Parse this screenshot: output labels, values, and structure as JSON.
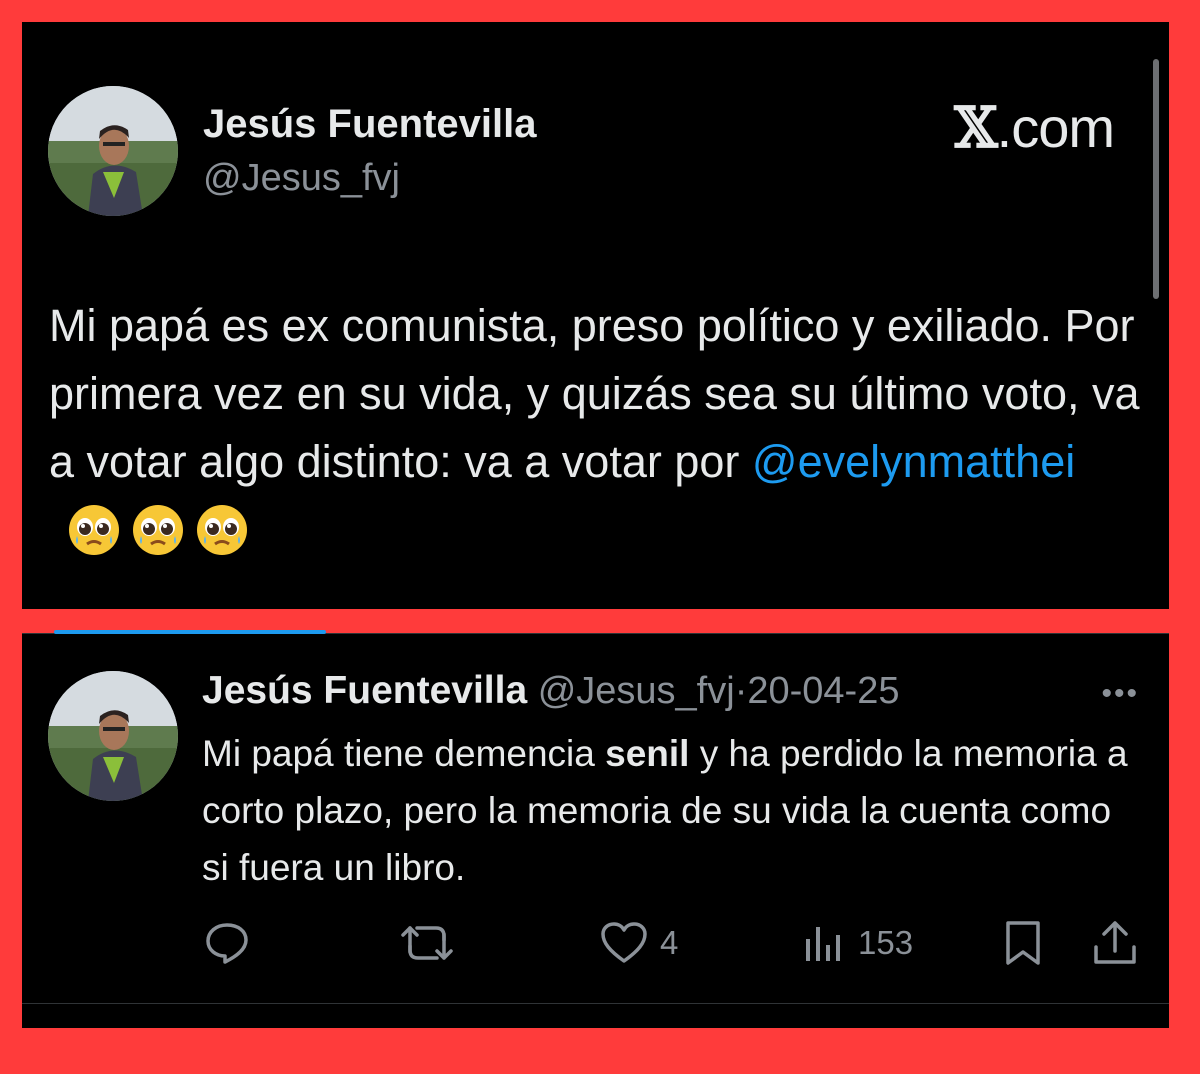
{
  "post": {
    "author_name": "Jesús Fuentevilla",
    "author_handle": "@Jesus_fvj",
    "brand": "X.com",
    "brand_x": "𝕏",
    "brand_rest": ".com",
    "text_intro": "Mi papá es ex comunista, preso político y exiliado. Por primera vez en su vida, y quizás sea su último voto, va a votar algo distinto: va a votar por ",
    "mention": "@evelynmatthei",
    "emojis": [
      "pleading-face",
      "pleading-face",
      "pleading-face"
    ]
  },
  "reply": {
    "author_name": "Jesús Fuentevilla",
    "author_handle": "@Jesus_fvj",
    "separator": "·",
    "date": "20-04-25",
    "more": "•••",
    "text_part1": "Mi papá tiene demencia ",
    "text_bold": "senil",
    "text_part2": " y ha perdido la memoria a corto plazo, pero la memoria de su vida la cuenta como si fuera un libro.",
    "actions": {
      "reply_count": "",
      "repost_count": "",
      "like_count": "4",
      "views_count": "153"
    }
  },
  "colors": {
    "frame": "#ff3b3b",
    "background": "#000000",
    "text": "#e7e9ea",
    "muted": "#8b9198",
    "accent": "#1d9bf0"
  }
}
